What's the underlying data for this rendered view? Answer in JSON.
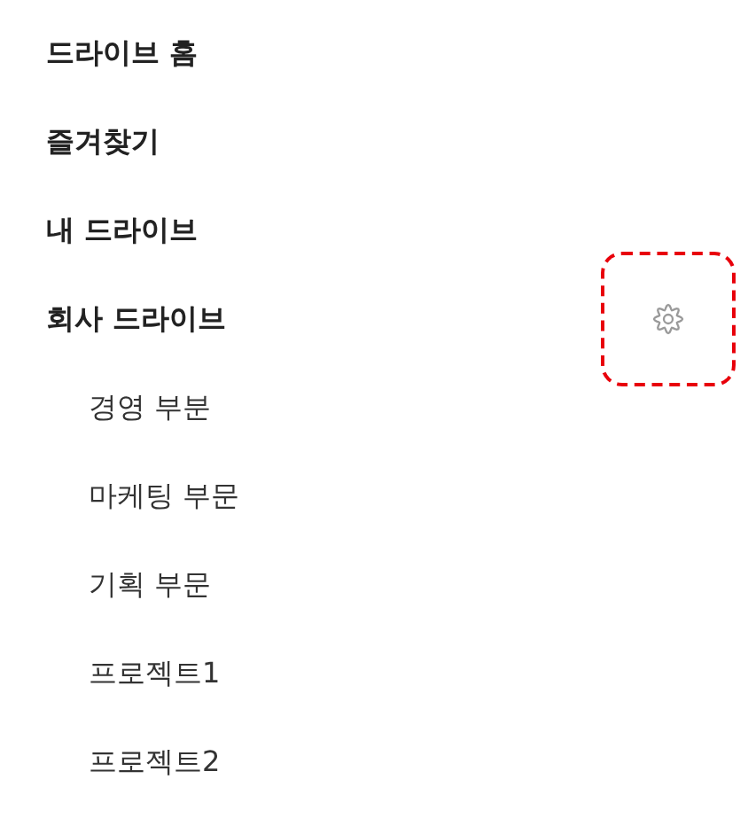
{
  "sidebar": {
    "items": [
      {
        "label": "드라이브 홈",
        "settings": false
      },
      {
        "label": "즐겨찾기",
        "settings": false
      },
      {
        "label": "내 드라이브",
        "settings": false
      },
      {
        "label": "회사 드라이브",
        "settings": true,
        "highlighted": true,
        "children": [
          {
            "label": "경영 부분"
          },
          {
            "label": "마케팅 부문"
          },
          {
            "label": "기획 부문"
          },
          {
            "label": "프로젝트1"
          },
          {
            "label": "프로젝트2"
          }
        ]
      }
    ]
  }
}
